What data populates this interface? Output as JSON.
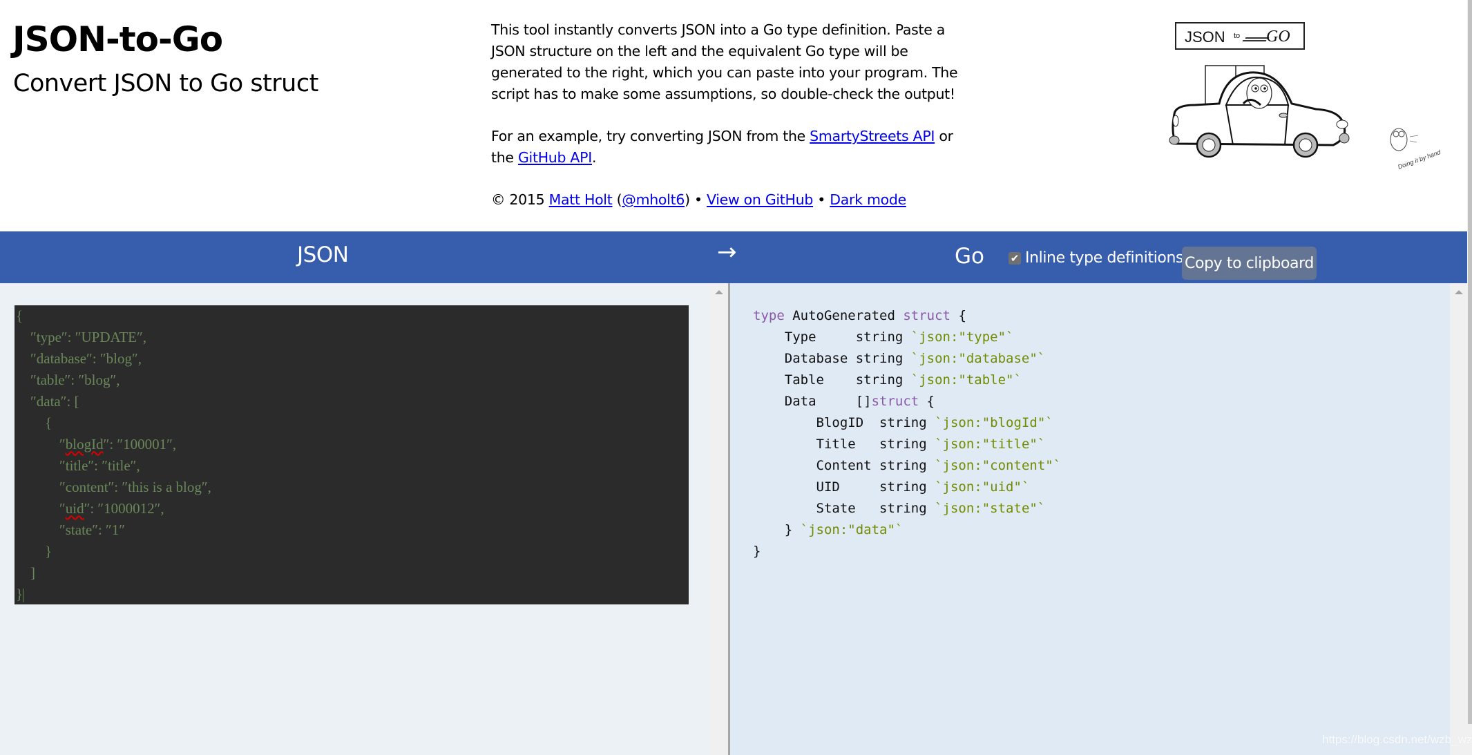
{
  "header": {
    "title": "JSON-to-Go",
    "subtitle": "Convert JSON to Go struct",
    "intro": "This tool instantly converts JSON into a Go type definition. Paste a JSON structure on the left and the equivalent Go type will be generated to the right, which you can paste into your program. The script has to make some assumptions, so double-check the output!",
    "example_prefix": "For an example, try converting JSON from the ",
    "example_link1": "SmartyStreets API",
    "example_mid": " or the ",
    "example_link2": "GitHub API",
    "example_suffix": ".",
    "copyright_prefix": "© 2015 ",
    "author_link": "Matt Holt",
    "handle_open": " (",
    "handle_link": "@mholt6",
    "handle_close": ") • ",
    "github_link": "View on GitHub",
    "sep": " • ",
    "dark_mode_link": "Dark mode"
  },
  "art": {
    "sign_json": "JSON",
    "sign_to": "to",
    "sign_go": "GO",
    "doodle_caption": "Doing it by hand"
  },
  "toolbar": {
    "json_label": "JSON",
    "arrow": "→",
    "go_label": "Go",
    "inline_checkbox_checked": true,
    "checkmark": "✔",
    "inline_label": "Inline type definitions",
    "copy_button": "Copy to clipboard"
  },
  "json_input": {
    "lines": [
      "{",
      "    ″type″: ″UPDATE″,",
      "    ″database″: ″blog″,",
      "    ″table″: ″blog″,",
      "    ″data″: [",
      "        {",
      "            ″blogId″: ″100001″,",
      "            ″title″: ″title″,",
      "            ″content″: ″this is a blog″,",
      "            ″uid″: ″1000012″,",
      "            ″state″: ″1″",
      "        }",
      "    ]",
      "}"
    ],
    "spellcheck_flagged": [
      "blogId",
      "uid"
    ]
  },
  "go_output": {
    "lines": [
      [
        {
          "t": "type",
          "c": "kw"
        },
        {
          "t": " AutoGenerated "
        },
        {
          "t": "struct",
          "c": "kw"
        },
        {
          "t": " {"
        }
      ],
      [
        {
          "t": "    Type     string "
        },
        {
          "t": "`json:\"type\"`",
          "c": "tag"
        }
      ],
      [
        {
          "t": "    Database string "
        },
        {
          "t": "`json:\"database\"`",
          "c": "tag"
        }
      ],
      [
        {
          "t": "    Table    string "
        },
        {
          "t": "`json:\"table\"`",
          "c": "tag"
        }
      ],
      [
        {
          "t": "    Data     []"
        },
        {
          "t": "struct",
          "c": "kw"
        },
        {
          "t": " {"
        }
      ],
      [
        {
          "t": "        BlogID  string "
        },
        {
          "t": "`json:\"blogId\"`",
          "c": "tag"
        }
      ],
      [
        {
          "t": "        Title   string "
        },
        {
          "t": "`json:\"title\"`",
          "c": "tag"
        }
      ],
      [
        {
          "t": "        Content string "
        },
        {
          "t": "`json:\"content\"`",
          "c": "tag"
        }
      ],
      [
        {
          "t": "        UID     string "
        },
        {
          "t": "`json:\"uid\"`",
          "c": "tag"
        }
      ],
      [
        {
          "t": "        State   string "
        },
        {
          "t": "`json:\"state\"`",
          "c": "tag"
        }
      ],
      [
        {
          "t": "    } "
        },
        {
          "t": "`json:\"data\"`",
          "c": "tag"
        }
      ],
      [
        {
          "t": "}"
        }
      ]
    ]
  },
  "watermark": "https://blog.csdn.net/wzb_wzt",
  "colors": {
    "bar": "#375ead",
    "copy_button": "#647493",
    "editor_bg": "#2b2b2b",
    "editor_text": "#6a8759",
    "keyword": "#8959a8",
    "tag": "#718c00",
    "link": "#0000ee"
  }
}
